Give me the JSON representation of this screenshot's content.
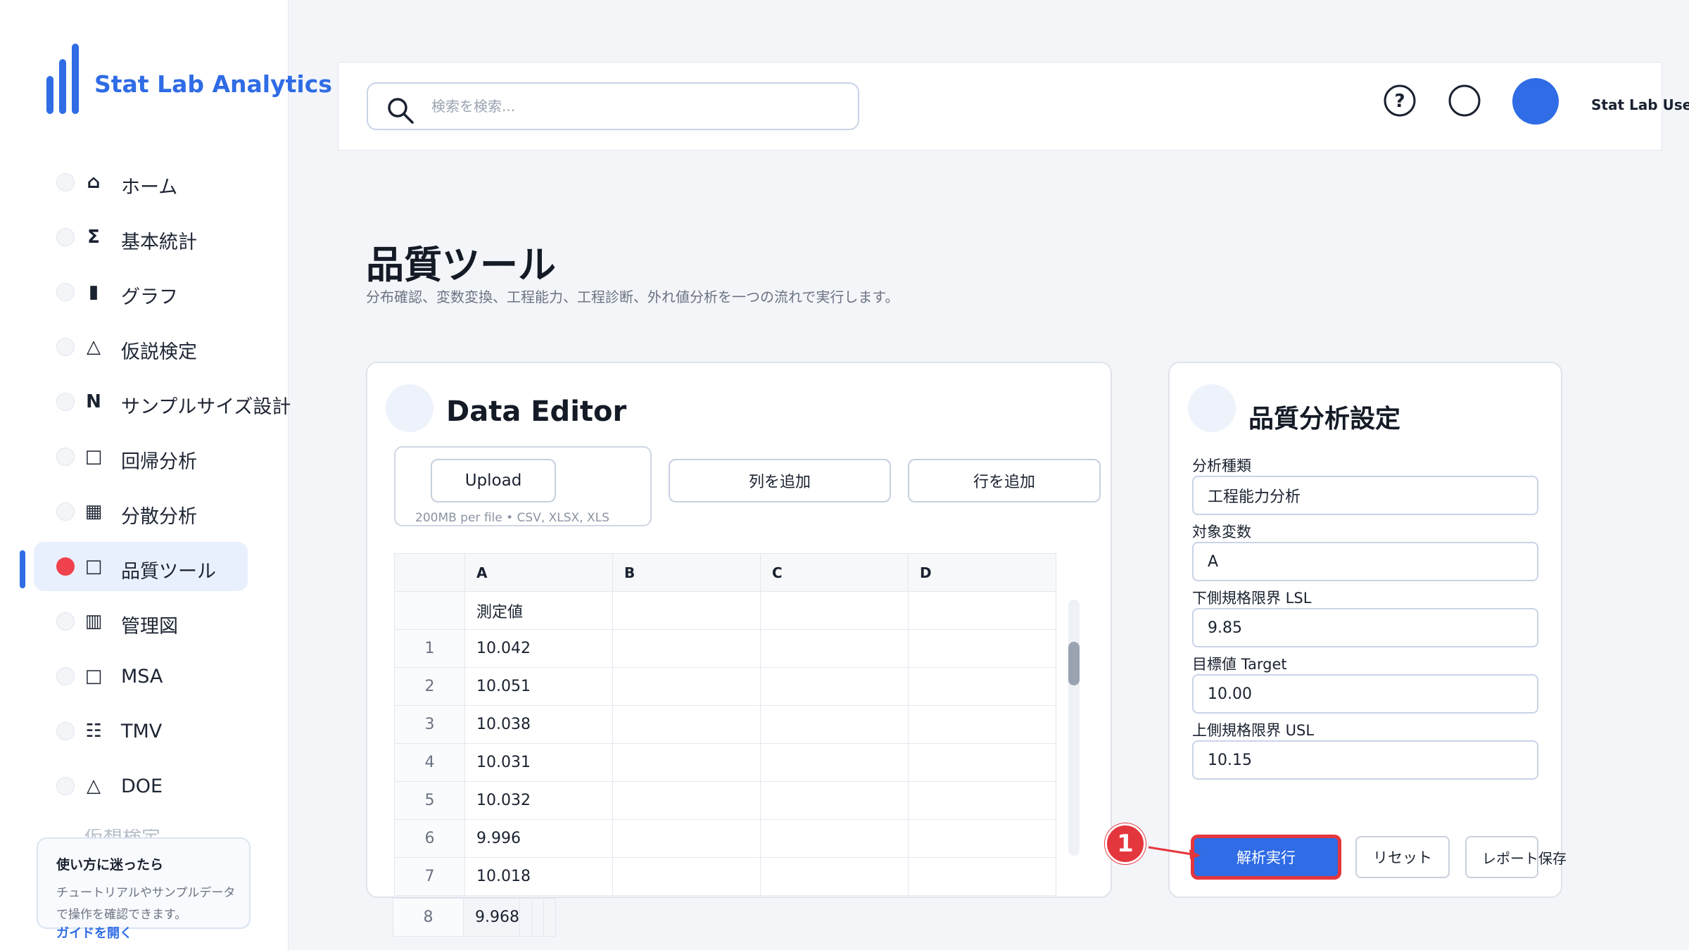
{
  "brand": {
    "name": "Stat Lab Analytics"
  },
  "sidebar": {
    "items": [
      {
        "icon": "⌂",
        "icon_name": "home-icon",
        "label": "ホーム",
        "active": false
      },
      {
        "icon": "Σ",
        "icon_name": "sigma-icon",
        "label": "基本統計",
        "active": false
      },
      {
        "icon": "▮",
        "icon_name": "bar-icon",
        "label": "グラフ",
        "active": false
      },
      {
        "icon": "△",
        "icon_name": "triangle-icon",
        "label": "仮説検定",
        "active": false
      },
      {
        "icon": "N",
        "icon_name": "n-icon",
        "label": "サンプルサイズ設計",
        "active": false
      },
      {
        "icon": "□",
        "icon_name": "square-icon",
        "label": "回帰分析",
        "active": false
      },
      {
        "icon": "▦",
        "icon_name": "grid-icon",
        "label": "分散分析",
        "active": false
      },
      {
        "icon": "□",
        "icon_name": "square-icon",
        "label": "品質ツール",
        "active": true
      },
      {
        "icon": "▥",
        "icon_name": "control-chart-icon",
        "label": "管理図",
        "active": false
      },
      {
        "icon": "□",
        "icon_name": "square-icon",
        "label": "MSA",
        "active": false
      },
      {
        "icon": "☷",
        "icon_name": "list-icon",
        "label": "TMV",
        "active": false
      },
      {
        "icon": "△",
        "icon_name": "triangle-icon",
        "label": "DOE",
        "active": false
      }
    ],
    "help": {
      "title": "使い方に迷ったら",
      "body": "チュートリアルやサンプルデータで操作を確認できます。",
      "link": "ガイドを開く"
    }
  },
  "header": {
    "search_placeholder": "検索を検索...",
    "user_name": "Stat Lab User"
  },
  "page": {
    "title": "品質ツール",
    "subtitle": "分布確認、変数変換、工程能力、工程診断、外れ値分析を一つの流れで実行します。"
  },
  "editor": {
    "title": "Data Editor",
    "upload_label": "Upload",
    "upload_hint": "200MB per file • CSV, XLSX, XLS",
    "add_column_label": "列を追加",
    "add_row_label": "行を追加",
    "columns": [
      "A",
      "B",
      "C",
      "D"
    ],
    "name_row": [
      "測定値",
      "",
      "",
      ""
    ],
    "rows": [
      {
        "index": "1",
        "values": [
          "10.042",
          "",
          "",
          ""
        ]
      },
      {
        "index": "2",
        "values": [
          "10.051",
          "",
          "",
          ""
        ]
      },
      {
        "index": "3",
        "values": [
          "10.038",
          "",
          "",
          ""
        ]
      },
      {
        "index": "4",
        "values": [
          "10.031",
          "",
          "",
          ""
        ]
      },
      {
        "index": "5",
        "values": [
          "10.032",
          "",
          "",
          ""
        ]
      },
      {
        "index": "6",
        "values": [
          "9.996",
          "",
          "",
          ""
        ]
      },
      {
        "index": "7",
        "values": [
          "10.018",
          "",
          "",
          ""
        ]
      },
      {
        "index": "8",
        "values": [
          "9.968",
          "",
          "",
          ""
        ]
      }
    ]
  },
  "settings": {
    "title": "品質分析設定",
    "fields": [
      {
        "label": "分析種類",
        "value": "工程能力分析"
      },
      {
        "label": "対象変数",
        "value": "A"
      },
      {
        "label": "下側規格限界 LSL",
        "value": "9.85"
      },
      {
        "label": "目標値 Target",
        "value": "10.00"
      },
      {
        "label": "上側規格限界 USL",
        "value": "10.15"
      }
    ],
    "run_label": "解析実行",
    "reset_label": "リセット",
    "save_label": "レポート保存"
  },
  "annotation": {
    "step": "1"
  },
  "colors": {
    "accent": "#2f6ce5",
    "highlight": "#e4363d"
  }
}
